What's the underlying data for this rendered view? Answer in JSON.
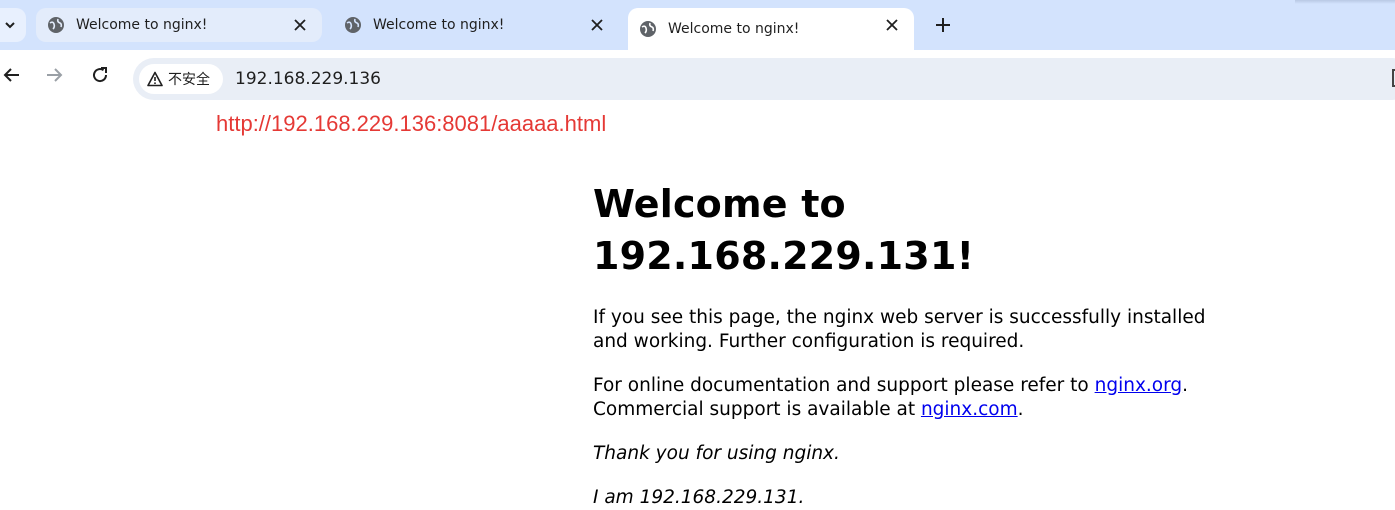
{
  "browser": {
    "tabs": [
      {
        "title": "Welcome to nginx!",
        "state": "inactive",
        "icon": "globe-icon"
      },
      {
        "title": "Welcome to nginx!",
        "state": "inactive",
        "icon": "globe-icon"
      },
      {
        "title": "Welcome to nginx!",
        "state": "active",
        "icon": "globe-icon"
      }
    ],
    "address_bar": {
      "security_label": "不安全",
      "url": "192.168.229.136"
    }
  },
  "annotation": {
    "text": "http://192.168.229.136:8081/aaaaa.html",
    "color": "#e53935"
  },
  "page": {
    "heading": "Welcome to 192.168.229.131!",
    "para1": "If you see this page, the nginx web server is successfully installed and working. Further configuration is required.",
    "para2_prefix": "For online documentation and support please refer to ",
    "link_org": "nginx.org",
    "para2_mid": ".",
    "para2_line2": "Commercial support is available at ",
    "link_com": "nginx.com",
    "para2_end": ".",
    "thanks": "Thank you for using nginx.",
    "iam": "I am 192.168.229.131."
  },
  "colors": {
    "tabstrip": "#d3e3fd",
    "omnibox": "#e9eef6",
    "link": "#0000ee"
  }
}
